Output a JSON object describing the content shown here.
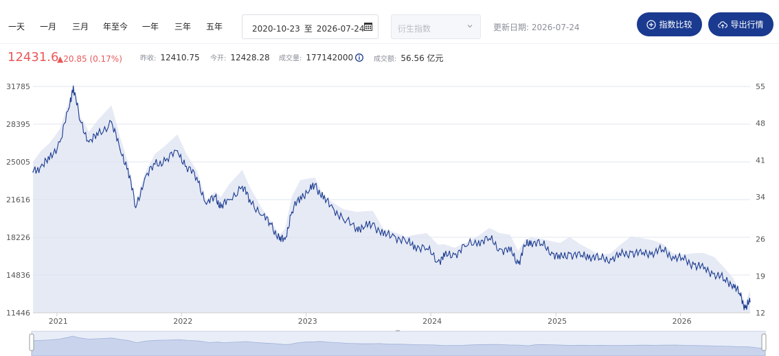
{
  "toolbar": {
    "ranges": [
      "一天",
      "一月",
      "三月",
      "年至今",
      "一年",
      "三年",
      "五年"
    ],
    "date_start": "2020-10-23",
    "date_sep": "至",
    "date_end": "2026-07-24",
    "calendar_icon": "calendar-icon",
    "derivative_placeholder": "衍生指数",
    "update_label": "更新日期:",
    "update_date": "2026-07-24",
    "compare_label": "指数比较",
    "export_label": "导出行情"
  },
  "quote": {
    "price": "12431.6",
    "change": "▲20.85 (0.17%)",
    "prev_close_label": "昨收:",
    "prev_close": "12410.75",
    "open_label": "今开:",
    "open": "12428.28",
    "volume_label": "成交量:",
    "volume": "177142000",
    "amount_label": "成交额:",
    "amount": "56.56 亿元"
  },
  "colors": {
    "accent": "#1a3a8f",
    "up": "#e8585a",
    "line": "#1a3a8f",
    "area": "#dde3f1"
  },
  "chart_data": {
    "type": "line",
    "y_left_ticks": [
      "31785",
      "28395",
      "25005",
      "21616",
      "18226",
      "14836",
      "11446"
    ],
    "y_right_ticks": [
      "55",
      "48",
      "41",
      "34",
      "26",
      "19",
      "12"
    ],
    "x_ticks": [
      "2021",
      "2022",
      "2023",
      "2024",
      "2025",
      "2026"
    ],
    "ylim_left": [
      11446,
      31785
    ],
    "ylim_right": [
      12,
      55
    ],
    "series": [
      {
        "type": "line",
        "x": [
          "2020-10-23",
          "2020-11-15",
          "2020-12-10",
          "2021-01-10",
          "2021-02-05",
          "2021-02-18",
          "2021-03-10",
          "2021-04-05",
          "2021-05-01",
          "2021-06-10",
          "2021-07-05",
          "2021-07-28",
          "2021-08-20",
          "2021-09-15",
          "2021-10-15",
          "2021-11-15",
          "2021-12-20",
          "2022-01-15",
          "2022-02-15",
          "2022-03-15",
          "2022-04-10",
          "2022-04-26",
          "2022-05-20",
          "2022-06-28",
          "2022-07-20",
          "2022-08-25",
          "2022-09-20",
          "2022-10-15",
          "2022-10-31",
          "2022-11-20",
          "2022-12-15",
          "2023-01-10",
          "2023-01-27",
          "2023-02-20",
          "2023-03-20",
          "2023-04-20",
          "2023-05-30",
          "2023-06-20",
          "2023-07-15",
          "2023-08-15",
          "2023-09-15",
          "2023-10-20",
          "2023-11-15",
          "2023-12-20",
          "2024-01-22",
          "2024-02-10",
          "2024-03-10",
          "2024-04-10",
          "2024-05-20",
          "2024-06-20",
          "2024-07-20",
          "2024-08-20",
          "2024-09-13",
          "2024-10-02",
          "2024-10-20",
          "2024-11-20",
          "2024-12-20",
          "2025-01-13",
          "2025-02-10",
          "2025-03-15",
          "2025-04-10",
          "2025-05-10",
          "2025-06-10",
          "2025-07-10",
          "2025-08-10",
          "2025-09-10",
          "2025-10-10",
          "2025-11-10",
          "2025-12-10",
          "2026-01-10",
          "2026-02-10",
          "2026-03-10",
          "2026-04-10",
          "2026-05-10",
          "2026-06-05",
          "2026-06-25",
          "2026-07-10",
          "2026-07-24"
        ],
        "values": [
          24100,
          24600,
          25200,
          26800,
          29800,
          31800,
          28700,
          26800,
          27400,
          28600,
          26100,
          24400,
          20900,
          23500,
          24800,
          25100,
          26000,
          24600,
          23600,
          21200,
          21900,
          20900,
          21600,
          22800,
          21600,
          20200,
          19400,
          18000,
          18050,
          20500,
          21900,
          22400,
          23000,
          21700,
          20900,
          19800,
          19100,
          19100,
          19500,
          18400,
          18400,
          17800,
          17500,
          17200,
          16100,
          16500,
          16700,
          17400,
          17900,
          18100,
          17200,
          17000,
          15900,
          17400,
          17900,
          17600,
          16900,
          16300,
          16800,
          16500,
          16600,
          16300,
          16300,
          16600,
          16900,
          16700,
          16900,
          17100,
          16500,
          16200,
          15800,
          15400,
          15000,
          14400,
          14000,
          13000,
          11900,
          12431.6
        ]
      }
    ]
  }
}
